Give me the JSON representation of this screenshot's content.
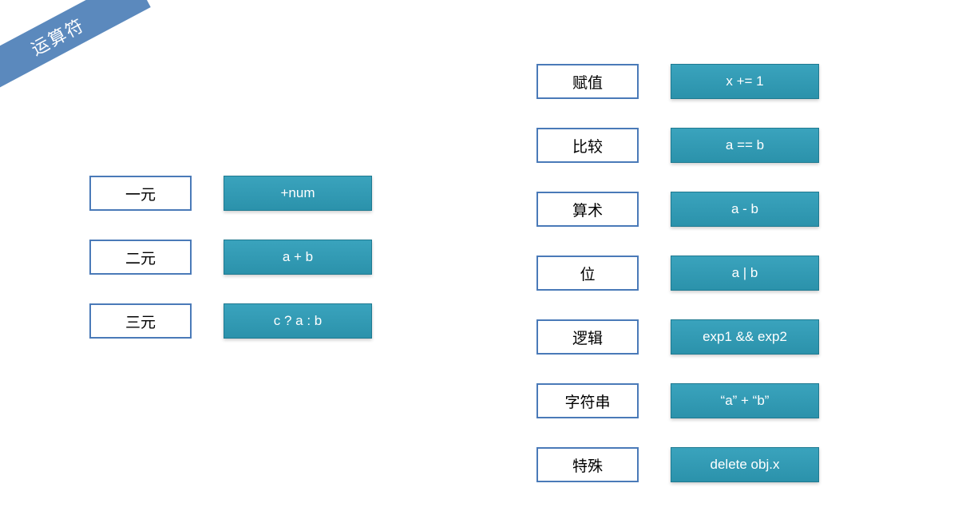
{
  "title": "运算符",
  "colors": {
    "ribbon": "#5b89bd",
    "category_border": "#4a7ab8",
    "example_bg": "#2e97b0",
    "example_text": "#ffffff"
  },
  "left_rows": [
    {
      "category": "一元",
      "example": "+num"
    },
    {
      "category": "二元",
      "example": "a + b"
    },
    {
      "category": "三元",
      "example": "c ? a : b"
    }
  ],
  "right_rows": [
    {
      "category": "赋值",
      "example": "x += 1"
    },
    {
      "category": "比较",
      "example": "a == b"
    },
    {
      "category": "算术",
      "example": "a - b"
    },
    {
      "category": "位",
      "example": "a | b"
    },
    {
      "category": "逻辑",
      "example": "exp1 && exp2"
    },
    {
      "category": "字符串",
      "example": "“a” + “b”"
    },
    {
      "category": "特殊",
      "example": "delete obj.x"
    }
  ]
}
